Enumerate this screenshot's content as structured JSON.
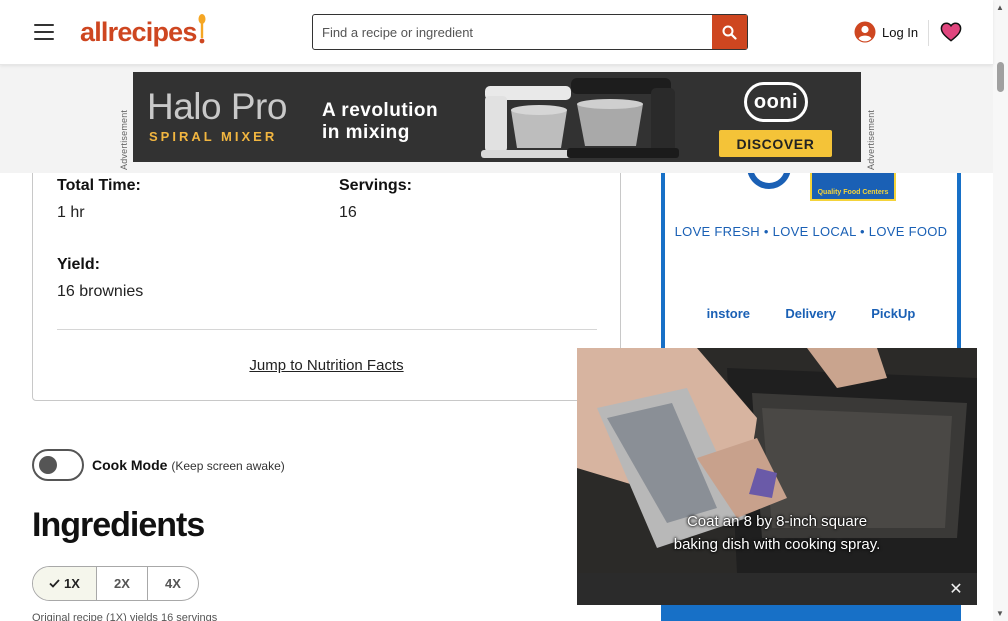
{
  "header": {
    "logo_text": "allrecipes",
    "search_placeholder": "Find a recipe or ingredient",
    "login_label": "Log In"
  },
  "ad_banner": {
    "advertisement_label": "Advertisement",
    "brand_title": "Halo Pro",
    "brand_subtitle": "SPIRAL MIXER",
    "tagline_line1": "A revolution",
    "tagline_line2": "in mixing",
    "logo": "ooni",
    "cta": "DISCOVER"
  },
  "details": {
    "total_time_label": "Total Time:",
    "total_time_value": "1 hr",
    "servings_label": "Servings:",
    "servings_value": "16",
    "yield_label": "Yield:",
    "yield_value": "16 brownies",
    "jump_link": "Jump to Nutrition Facts"
  },
  "cook_mode": {
    "label": "Cook Mode",
    "sublabel": "(Keep screen awake)",
    "enabled": false
  },
  "ingredients": {
    "heading": "Ingredients",
    "scale_options": [
      "1X",
      "2X",
      "4X"
    ],
    "selected_scale": "1X",
    "yield_note": "Original recipe (1X) yields 16 servings"
  },
  "rail_ad": {
    "logo_sub": "Quality Food Centers",
    "tagline": "LOVE FRESH • LOVE LOCAL • LOVE FOOD",
    "services": [
      "instore",
      "Delivery",
      "PickUp"
    ]
  },
  "video": {
    "caption_line1": "Coat an 8 by 8-inch square",
    "caption_line2": "baking dish with cooking spray.",
    "close_symbol": "✕"
  },
  "colors": {
    "brand": "#ce4620",
    "ad_dark": "#323232",
    "ad_yellow": "#f4c338",
    "rail_blue": "#1770c7",
    "heart_pink": "#e0467e"
  },
  "icons": {
    "menu": "hamburger-icon",
    "search": "search-icon",
    "account": "user-icon",
    "favorites": "heart-icon",
    "close": "close-icon",
    "check": "check-icon"
  }
}
